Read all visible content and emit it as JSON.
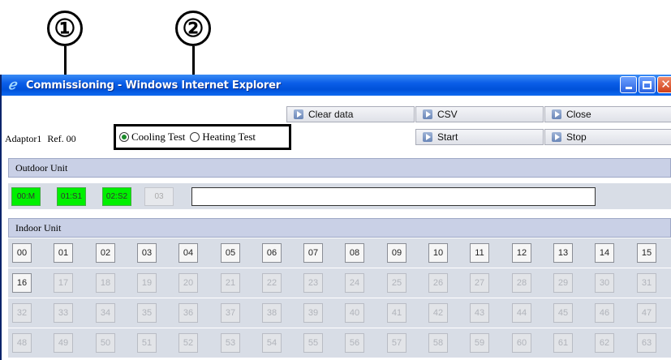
{
  "callouts": {
    "one": "①",
    "two": "②"
  },
  "window": {
    "title": "Commissioning - Windows Internet Explorer",
    "icon": "ie-icon"
  },
  "toolbar": {
    "clear_data": "Clear data",
    "csv": "CSV",
    "close": "Close",
    "start": "Start",
    "stop": "Stop"
  },
  "adaptor": {
    "label": "Adaptor1",
    "ref": "Ref. 00"
  },
  "mode": {
    "cooling": {
      "label": "Cooling Test",
      "selected": true
    },
    "heating": {
      "label": "Heating Test",
      "selected": false
    }
  },
  "outdoor": {
    "heading": "Outdoor Unit",
    "units": [
      {
        "label": "00:M",
        "active": true
      },
      {
        "label": "01:S1",
        "active": true
      },
      {
        "label": "02:S2",
        "active": true
      },
      {
        "label": "03",
        "active": false
      }
    ],
    "message": ""
  },
  "indoor": {
    "heading": "Indoor Unit",
    "rows": [
      [
        "00",
        "01",
        "02",
        "03",
        "04",
        "05",
        "06",
        "07",
        "08",
        "09",
        "10",
        "11",
        "12",
        "13",
        "14",
        "15"
      ],
      [
        "16",
        "17",
        "18",
        "19",
        "20",
        "21",
        "22",
        "23",
        "24",
        "25",
        "26",
        "27",
        "28",
        "29",
        "30",
        "31"
      ],
      [
        "32",
        "33",
        "34",
        "35",
        "36",
        "37",
        "38",
        "39",
        "40",
        "41",
        "42",
        "43",
        "44",
        "45",
        "46",
        "47"
      ],
      [
        "48",
        "49",
        "50",
        "51",
        "52",
        "53",
        "54",
        "55",
        "56",
        "57",
        "58",
        "59",
        "60",
        "61",
        "62",
        "63"
      ]
    ],
    "enabled": [
      "00",
      "01",
      "02",
      "03",
      "04",
      "05",
      "06",
      "07",
      "08",
      "09",
      "10",
      "11",
      "12",
      "13",
      "14",
      "15",
      "16"
    ]
  },
  "colors": {
    "active_unit": "#00f000",
    "titlebar": "#0b5ee8",
    "band": "#c9d0e6"
  }
}
